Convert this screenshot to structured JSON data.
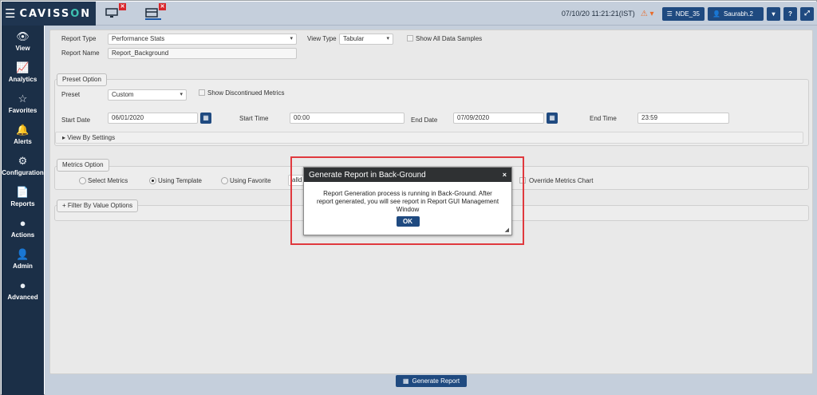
{
  "app": {
    "logo": "CAVISSON",
    "menu_icon": "hamburger-icon",
    "datetime": "07/10/20 11:21:21(IST)",
    "nde_label": "NDE_35",
    "user_label": "Saurabh.2",
    "help_label": "?",
    "tab_badges": [
      "✕",
      "✕"
    ]
  },
  "nav": [
    {
      "icon": "eye-icon",
      "glyph": "👁",
      "label": "View"
    },
    {
      "icon": "chart-line-icon",
      "glyph": "📈",
      "label": "Analytics"
    },
    {
      "icon": "star-icon",
      "glyph": "☆",
      "label": "Favorites"
    },
    {
      "icon": "bell-icon",
      "glyph": "🔔",
      "label": "Alerts"
    },
    {
      "icon": "gears-icon",
      "glyph": "⚙",
      "label": "Configuration"
    },
    {
      "icon": "document-icon",
      "glyph": "📄",
      "label": "Reports"
    },
    {
      "icon": "actions-icon",
      "glyph": "●",
      "label": "Actions"
    },
    {
      "icon": "user-icon",
      "glyph": "👤",
      "label": "Admin"
    },
    {
      "icon": "advanced-icon",
      "glyph": "●",
      "label": "Advanced"
    }
  ],
  "form": {
    "report_type_label": "Report Type",
    "report_type_value": "Performance Stats",
    "view_type_label": "View Type",
    "view_type_value": "Tabular",
    "show_all_label": "Show All Data Samples",
    "report_name_label": "Report Name",
    "report_name_value": "Report_Background",
    "preset_option_legend": "Preset Option",
    "preset_label": "Preset",
    "preset_value": "Custom",
    "show_discontinued_label": "Show Discontinued Metrics",
    "start_date_label": "Start Date",
    "start_date_value": "06/01/2020",
    "start_time_label": "Start Time",
    "start_time_value": "00:00",
    "end_date_label": "End Date",
    "end_date_value": "07/09/2020",
    "end_time_label": "End Time",
    "end_time_value": "23:59",
    "view_by_settings": "▸  View By Settings",
    "metrics_option_legend": "Metrics Option",
    "select_metrics_label": "Select Metrics",
    "using_template_label": "Using Template",
    "using_favorite_label": "Using Favorite",
    "template_value_partial": "alld",
    "override_label": "Override Metrics Chart",
    "filter_by_value": "+ Filter By Value Options",
    "generate_report": "Generate Report"
  },
  "modal": {
    "title": "Generate Report in Back-Ground",
    "close": "×",
    "message": "Report Generation process is running in Back-Ground. After report generated, you will see report in Report GUI Management Window",
    "ok": "OK"
  },
  "colors": {
    "nav_bg": "#1b2f47",
    "topbar_bg": "#c5cfdc",
    "accent_button": "#1f4a80",
    "highlight": "#e0393e",
    "modal_header": "#2f3133"
  }
}
